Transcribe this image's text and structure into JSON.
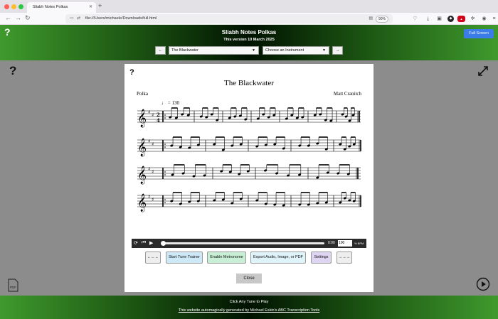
{
  "browser": {
    "tab_title": "Sliabh Notes Polkas",
    "url": "file:///Users/michaele/Downloads/full.html",
    "zoom": "90%",
    "colors": {
      "close": "#ff5f57",
      "minimize": "#febc2e",
      "maximize": "#28c840"
    }
  },
  "header": {
    "help": "?",
    "title": "Sliabh Notes Polkas",
    "subtitle": "This version 10 March 2025",
    "prev_label": "←",
    "next_label": "→",
    "tune_select": "The Blackwater",
    "instrument_select": "Choose an Instrument",
    "fullscreen_label": "Full Screen"
  },
  "page": {
    "help": "?",
    "pdf_label": "PDF"
  },
  "modal": {
    "help": "?",
    "tune_title": "The Blackwater",
    "rhythm": "Polka",
    "composer": "Matt Cranitch",
    "tempo_note": "♩",
    "tempo": "= 130",
    "player": {
      "time": "0:00",
      "tempo_value": "100",
      "unit": "% BPM"
    },
    "buttons": {
      "prev": "←←←",
      "trainer": "Start Tune Trainer",
      "metronome": "Enable Metronome",
      "export": "Export Audio, Image, or PDF",
      "settings": "Settings",
      "next": "→→→",
      "close": "Close"
    }
  },
  "footer": {
    "line1": "Click Any Tune to Play",
    "line2": "This website automagically generated by Michael Eskin's ABC Transcription Tools"
  }
}
